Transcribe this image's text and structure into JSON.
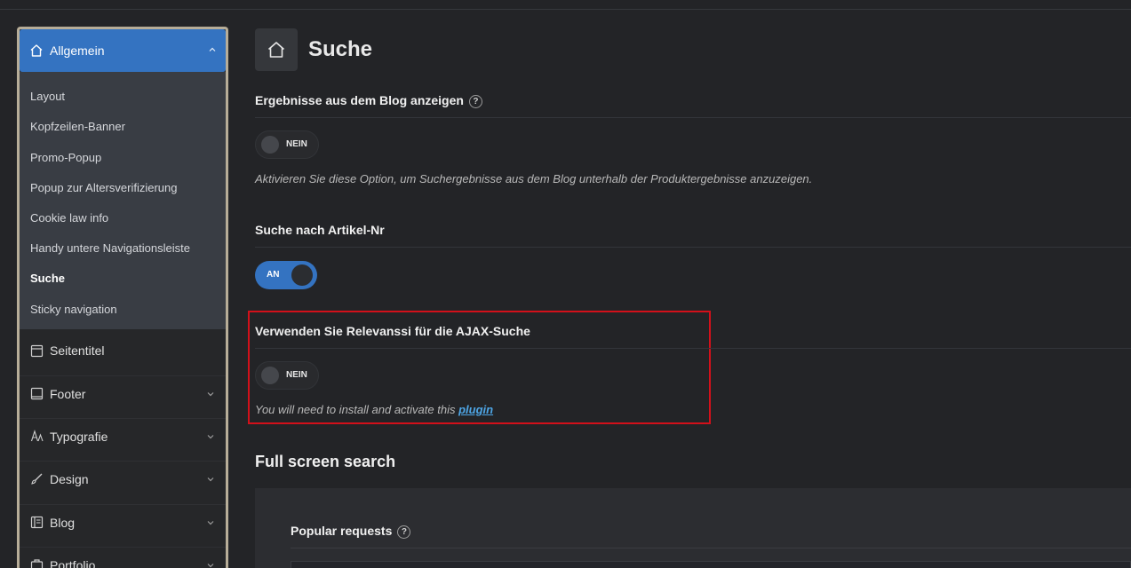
{
  "sidebar": {
    "active_section": "Allgemein",
    "subitems": [
      {
        "label": "Layout",
        "active": false
      },
      {
        "label": "Kopfzeilen-Banner",
        "active": false
      },
      {
        "label": "Promo-Popup",
        "active": false
      },
      {
        "label": "Popup zur Altersverifizierung",
        "active": false
      },
      {
        "label": "Cookie law info",
        "active": false
      },
      {
        "label": "Handy untere Navigationsleiste",
        "active": false
      },
      {
        "label": "Suche",
        "active": true
      },
      {
        "label": "Sticky navigation",
        "active": false
      }
    ],
    "items": [
      {
        "label": "Seitentitel",
        "icon": "page-icon"
      },
      {
        "label": "Footer",
        "icon": "footer-icon"
      },
      {
        "label": "Typografie",
        "icon": "typography-icon"
      },
      {
        "label": "Design",
        "icon": "brush-icon"
      },
      {
        "label": "Blog",
        "icon": "blog-icon"
      },
      {
        "label": "Portfolio",
        "icon": "portfolio-icon"
      }
    ]
  },
  "main": {
    "title": "Suche",
    "title_icon": "home-icon",
    "fields": [
      {
        "label": "Ergebnisse aus dem Blog anzeigen",
        "help": "?",
        "toggle": "NEIN",
        "description": "Aktivieren Sie diese Option, um Suchergebnisse aus dem Blog unterhalb der Produktergebnisse anzuzeigen."
      },
      {
        "label": "Suche nach Artikel-Nr",
        "toggle": "AN"
      },
      {
        "label": "Verwenden Sie Relevanssi für die AJAX-Suche",
        "toggle": "NEIN",
        "description_prefix": "You will need to install and activate this",
        "description_link": "plugin"
      }
    ],
    "full_screen": {
      "title": "Full screen search",
      "popular_label": "Popular requests",
      "help": "?"
    }
  },
  "colors": {
    "accent": "#3473c1",
    "highlight": "#d3101a",
    "background": "#232427",
    "link": "#4ea6e6"
  }
}
